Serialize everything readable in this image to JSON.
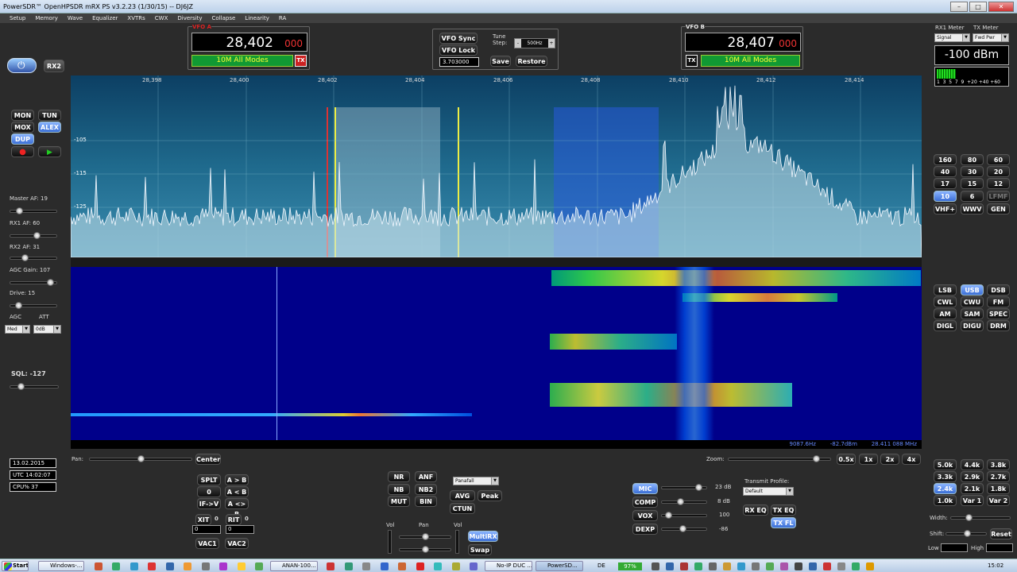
{
  "window": {
    "title": "PowerSDR™ OpenHPSDR mRX PS v3.2.23 (1/30/15)  --  DJ6JZ"
  },
  "menu": [
    "Setup",
    "Memory",
    "Wave",
    "Equalizer",
    "XVTRs",
    "CWX",
    "Diversity",
    "Collapse",
    "Linearity",
    "RA"
  ],
  "vfo_a": {
    "label": "VFO A",
    "freq_main": "28,402",
    "freq_sub": "000",
    "band": "10M All Modes",
    "tx": "TX"
  },
  "vfo_b": {
    "label": "VFO B",
    "freq_main": "28,407",
    "freq_sub": "000",
    "band": "10M All Modes",
    "tx": "TX"
  },
  "vfo_ctrl": {
    "sync": "VFO Sync",
    "lock": "VFO Lock",
    "tune_step_label": "Tune Step:",
    "tune_step": "500Hz",
    "freq_box": "3.703000",
    "save": "Save",
    "restore": "Restore"
  },
  "meters": {
    "rx1_label": "RX1 Meter",
    "tx_label": "TX Meter",
    "rx1_mode": "Signal",
    "tx_mode": "Fwd Pwr",
    "reading": "-100 dBm",
    "scale": "1  3  5  7  9  +20 +40 +60"
  },
  "left": {
    "rx2": "RX2",
    "mon": "MON",
    "tun": "TUN",
    "mox": "MOX",
    "alex": "ALEX",
    "dup": "DUP",
    "master_af": "Master AF:  19",
    "rx1_af": "RX1 AF:  60",
    "rx2_af": "RX2 AF:  31",
    "agc_gain": "AGC Gain:  107",
    "drive": "Drive:  15",
    "agc": "AGC",
    "att": "ATT",
    "agc_val": "Med",
    "att_val": "0dB",
    "sql": "SQL:  -127",
    "date": "13.02.2015",
    "utc": "UTC 14:02:07",
    "cpu": "CPU%  37"
  },
  "spectrum": {
    "freq_ticks": [
      "28,398",
      "28,400",
      "28,402",
      "28,404",
      "28,406",
      "28,408",
      "28,410",
      "28,412",
      "28,414"
    ],
    "db_ticks": [
      "-105",
      "-115",
      "-125"
    ],
    "status": "9087.6Hz        -82.7dBm        28.411 088 MHz"
  },
  "bands": [
    "160",
    "80",
    "60",
    "40",
    "30",
    "20",
    "17",
    "15",
    "12",
    "10",
    "6",
    "LFMF",
    "VHF+",
    "WWV",
    "GEN"
  ],
  "modes": [
    "LSB",
    "USB",
    "DSB",
    "CWL",
    "CWU",
    "FM",
    "AM",
    "SAM",
    "SPEC",
    "DIGL",
    "DIGU",
    "DRM"
  ],
  "filters": [
    "5.0k",
    "4.4k",
    "3.8k",
    "3.3k",
    "2.9k",
    "2.7k",
    "2.4k",
    "2.1k",
    "1.8k",
    "1.0k",
    "Var 1",
    "Var 2"
  ],
  "bottom": {
    "pan": "Pan:",
    "center": "Center",
    "zoom": "Zoom:",
    "z05": "0.5x",
    "z1": "1x",
    "z2": "2x",
    "z4": "4x",
    "splt": "SPLT",
    "ab": "A > B",
    "zbeat": "0 Beat",
    "ba": "A < B",
    "ifv": "IF->V",
    "aswap": "A <> B",
    "xit": "XIT",
    "xit_v": "0",
    "rit": "RIT",
    "rit_v": "0",
    "xit_num": "0",
    "rit_num": "0",
    "vac1": "VAC1",
    "vac2": "VAC2",
    "nr": "NR",
    "anf": "ANF",
    "nb": "NB",
    "nb2": "NB2",
    "mut": "MUT",
    "bin": "BIN",
    "display": "Panafall",
    "avg": "AVG",
    "peak": "Peak",
    "ctun": "CTUN",
    "vol1": "Vol",
    "pan2": "Pan",
    "vol2": "Vol",
    "multirx": "MultiRX",
    "swap": "Swap",
    "mic": "MIC",
    "mic_v": "23 dB",
    "comp": "COMP",
    "comp_v": "8 dB",
    "vox": "VOX",
    "vox_v": "100",
    "dexp": "DEXP",
    "dexp_v": "-86",
    "tx_profile": "Transmit Profile:",
    "tx_profile_v": "Default",
    "rxeq": "RX EQ",
    "txeq": "TX EQ",
    "txfl": "TX FL",
    "width": "Width:",
    "shift": "Shift:",
    "reset": "Reset",
    "low": "Low",
    "high": "High"
  },
  "taskbar": {
    "start": "Start",
    "items": [
      "Windows-...",
      "ANAN-100...",
      "No-IP DUC ...",
      "PowerSD..."
    ],
    "lang": "DE",
    "battery": "97%",
    "clock": "15:02"
  }
}
